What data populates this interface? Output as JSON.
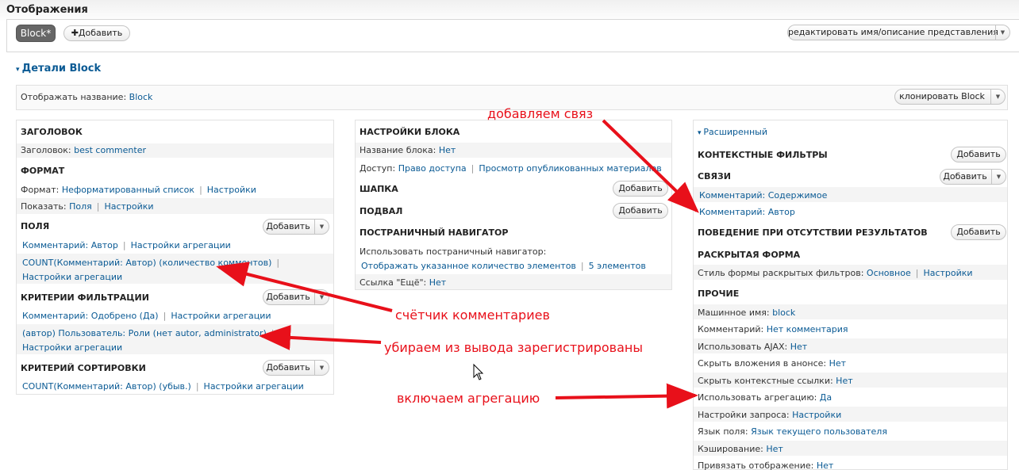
{
  "page_title": "Отображения",
  "tabs": {
    "block": "Block*",
    "add": "✚Добавить"
  },
  "edit_view": "редактировать имя/описание представления",
  "details": {
    "title": "Детали Block",
    "display_name_label": "Отображать название:",
    "display_name_value": "Block",
    "clone": "клонировать Block"
  },
  "add_label": "Добавить",
  "left": {
    "header_h": "ЗАГОЛОВОК",
    "header_label": "Заголовок:",
    "header_value": "best commenter",
    "format_h": "ФОРМАТ",
    "format_label": "Формат:",
    "format_value": "Неформатированный список",
    "format_settings": "Настройки",
    "show_label": "Показать:",
    "show_value": "Поля",
    "show_settings": "Настройки",
    "fields_h": "ПОЛЯ",
    "field1": "Комментарий: Автор",
    "field1_agg": "Настройки агрегации",
    "field2": "COUNT(Комментарий: Автор) (количество комментов)",
    "field2_agg": "Настройки агрегации",
    "filters_h": "КРИТЕРИИ ФИЛЬТРАЦИИ",
    "filter1": "Комментарий: Одобрено (Да)",
    "filter1_agg": "Настройки агрегации",
    "filter2": "(автор) Пользователь: Роли (нет autor, administrator)",
    "filter2_agg": "Настройки агрегации",
    "sort_h": "КРИТЕРИЙ СОРТИРОВКИ",
    "sort1": "COUNT(Комментарий: Автор) (убыв.)",
    "sort1_agg": "Настройки агрегации"
  },
  "middle": {
    "block_h": "НАСТРОЙКИ БЛОКА",
    "block_name_label": "Название блока:",
    "block_name_value": "Нет",
    "access_label": "Доступ:",
    "access_value": "Право доступа",
    "access_perm": "Просмотр опубликованных материалов",
    "header_h": "ШАПКА",
    "footer_h": "ПОДВАЛ",
    "pager_h": "ПОСТРАНИЧНЫЙ НАВИГАТОР",
    "pager_label": "Использовать постраничный навигатор:",
    "pager_value": "Отображать указанное количество элементов",
    "pager_items": "5 элементов",
    "more_label": "Ссылка \"Ещё\":",
    "more_value": "Нет"
  },
  "right": {
    "advanced": "Расширенный",
    "ctx_h": "КОНТЕКСТНЫЕ ФИЛЬТРЫ",
    "rel_h": "СВЯЗИ",
    "rel1": "Комментарий: Содержимое",
    "rel2": "Комментарий: Автор",
    "noresult_h": "ПОВЕДЕНИЕ ПРИ ОТСУТСТВИИ РЕЗУЛЬТАТОВ",
    "exposed_h": "РАСКРЫТАЯ ФОРМА",
    "exposed_label": "Стиль формы раскрытых фильтров:",
    "exposed_value": "Основное",
    "exposed_settings": "Настройки",
    "other_h": "ПРОЧИЕ",
    "machine_label": "Машинное имя:",
    "machine_value": "block",
    "comment_label": "Комментарий:",
    "comment_value": "Нет комментария",
    "ajax_label": "Использовать AJAX:",
    "ajax_value": "Нет",
    "attach_label": "Скрыть вложения в анонсе:",
    "attach_value": "Нет",
    "ctxlinks_label": "Скрыть контекстные ссылки:",
    "ctxlinks_value": "Нет",
    "agg_label": "Использовать агрегацию:",
    "agg_value": "Да",
    "query_label": "Настройки запроса:",
    "query_value": "Настройки",
    "lang_label": "Язык поля:",
    "lang_value": "Язык текущего пользователя",
    "cache_label": "Кэширование:",
    "cache_value": "Нет",
    "bind_label": "Привязать отображение:",
    "bind_value": "Нет"
  },
  "annotations": {
    "a1": "добавляем связ",
    "a2": "счётчик комментариев",
    "a3": "убираем из вывода зарегистрированы",
    "a4": "включаем агрегацию"
  },
  "colors": {
    "link": "#0a5a94",
    "annotation": "#e8101a"
  }
}
